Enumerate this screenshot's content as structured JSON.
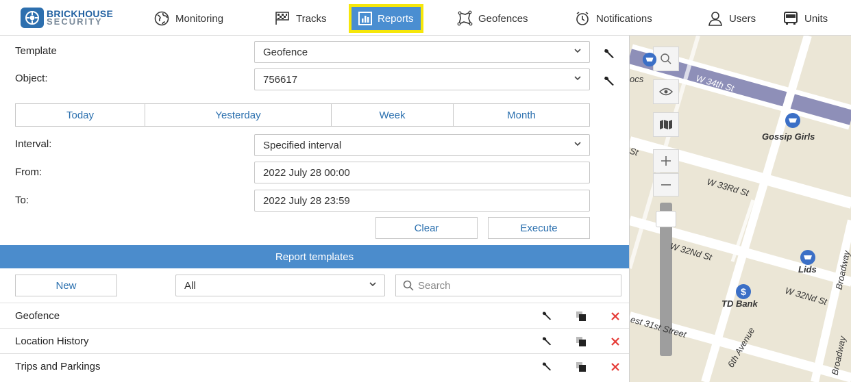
{
  "brand": {
    "name": "BRICKHOUSE",
    "sub": "SECURITY"
  },
  "nav": [
    {
      "id": "monitoring",
      "label": "Monitoring",
      "icon": "globe-icon"
    },
    {
      "id": "tracks",
      "label": "Tracks",
      "icon": "checkered-flag-icon"
    },
    {
      "id": "reports",
      "label": "Reports",
      "icon": "bar-chart-icon",
      "active": true
    },
    {
      "id": "geofences",
      "label": "Geofences",
      "icon": "polygon-icon"
    },
    {
      "id": "notifications",
      "label": "Notifications",
      "icon": "clock-bell-icon"
    },
    {
      "id": "users",
      "label": "Users",
      "icon": "user-icon"
    },
    {
      "id": "units",
      "label": "Units",
      "icon": "bus-icon"
    }
  ],
  "form": {
    "template_label": "Template",
    "template_value": "Geofence",
    "object_label": "Object:",
    "object_value": "756617",
    "periods": [
      "Today",
      "Yesterday",
      "Week",
      "Month"
    ],
    "interval_label": "Interval:",
    "interval_value": "Specified interval",
    "from_label": "From:",
    "from_value": "2022 July 28 00:00",
    "to_label": "To:",
    "to_value": "2022 July 28 23:59",
    "clear_label": "Clear",
    "execute_label": "Execute"
  },
  "templates": {
    "header": "Report templates",
    "new_label": "New",
    "filter_value": "All",
    "search_placeholder": "Search",
    "items": [
      {
        "name": "Geofence"
      },
      {
        "name": "Location History"
      },
      {
        "name": "Trips and Parkings"
      }
    ]
  },
  "map": {
    "streets": [
      "W 34th St",
      "W 33Rd St",
      "W 32Nd St",
      "W 32Nd St",
      "est 31st Street",
      "6th Avenue",
      "Broadway",
      "Broadway",
      "St",
      "ocs"
    ],
    "pois": [
      "Gossip Girls",
      "Lids",
      "TD Bank"
    ]
  },
  "colors": {
    "accent": "#4a8ed1",
    "highlight": "#f6e70a",
    "link": "#2a6fae",
    "danger": "#e53935",
    "section": "#4b8ccc"
  }
}
